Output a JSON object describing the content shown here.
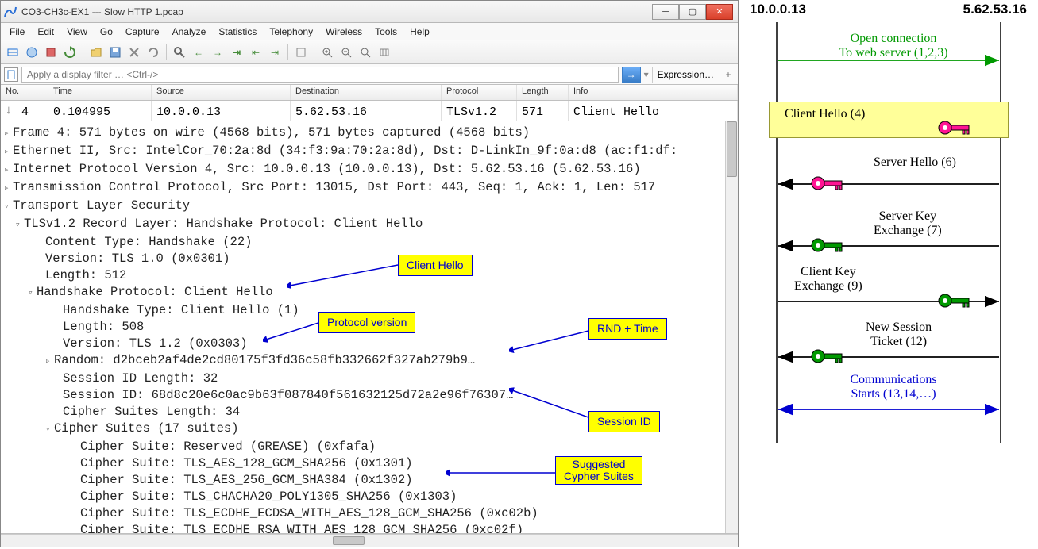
{
  "titlebar": {
    "title": "CO3-CH3c-EX1 --- Slow HTTP 1.pcap"
  },
  "menu": {
    "items": [
      "File",
      "Edit",
      "View",
      "Go",
      "Capture",
      "Analyze",
      "Statistics",
      "Telephony",
      "Wireless",
      "Tools",
      "Help"
    ]
  },
  "filter": {
    "placeholder": "Apply a display filter … <Ctrl-/>",
    "expression": "Expression…"
  },
  "packet_list": {
    "columns": [
      "No.",
      "Time",
      "Source",
      "Destination",
      "Protocol",
      "Length",
      "Info"
    ],
    "row": {
      "no": "4",
      "time": "0.104995",
      "src": "10.0.0.13",
      "dst": "5.62.53.16",
      "proto": "TLSv1.2",
      "len": "571",
      "info": "Client Hello"
    }
  },
  "details": {
    "frame": "Frame 4: 571 bytes on wire (4568 bits), 571 bytes captured (4568 bits)",
    "eth": "Ethernet II, Src: IntelCor_70:2a:8d (34:f3:9a:70:2a:8d), Dst: D-LinkIn_9f:0a:d8 (ac:f1:df:",
    "ip": "Internet Protocol Version 4, Src: 10.0.0.13 (10.0.0.13), Dst: 5.62.53.16 (5.62.53.16)",
    "tcp": "Transmission Control Protocol, Src Port: 13015, Dst Port: 443, Seq: 1, Ack: 1, Len: 517",
    "tls": "Transport Layer Security",
    "record": "TLSv1.2 Record Layer: Handshake Protocol: Client Hello",
    "ctype": "Content Type: Handshake (22)",
    "ver_rec": "Version: TLS 1.0 (0x0301)",
    "len_rec": "Length: 512",
    "hsproto": "Handshake Protocol: Client Hello",
    "hstype": "Handshake Type: Client Hello (1)",
    "hs_len": "Length: 508",
    "hs_ver": "Version: TLS 1.2 (0x0303)",
    "random": "Random: d2bceb2af4de2cd80175f3fd36c58fb332662f327ab279b9…",
    "sid_len": "Session ID Length: 32",
    "sid": "Session ID: 68d8c20e6c0ac9b63f087840f561632125d72a2e96f76307…",
    "cs_len": "Cipher Suites Length: 34",
    "cs_head": "Cipher Suites (17 suites)",
    "cs1": "Cipher Suite: Reserved (GREASE) (0xfafa)",
    "cs2": "Cipher Suite: TLS_AES_128_GCM_SHA256 (0x1301)",
    "cs3": "Cipher Suite: TLS_AES_256_GCM_SHA384 (0x1302)",
    "cs4": "Cipher Suite: TLS_CHACHA20_POLY1305_SHA256 (0x1303)",
    "cs5": "Cipher Suite: TLS_ECDHE_ECDSA_WITH_AES_128_GCM_SHA256 (0xc02b)",
    "cs6": "Cipher Suite: TLS ECDHE RSA WITH AES 128 GCM SHA256 (0xc02f)"
  },
  "annotations": {
    "client_hello": "Client Hello",
    "proto_ver": "Protocol version",
    "rnd_time": "RND + Time",
    "session_id": "Session ID",
    "cyphers": "Suggested\nCypher Suites"
  },
  "seq": {
    "left_addr": "10.0.0.13",
    "right_addr": "5.62.53.16",
    "open": "Open connection\nTo web server (1,2,3)",
    "client_hello": "Client Hello (4)",
    "server_hello": "Server Hello (6)",
    "skey": "Server Key\nExchange (7)",
    "ckey": "Client Key\nExchange (9)",
    "ticket": "New Session\nTicket (12)",
    "comm": "Communications\nStarts (13,14,…)"
  }
}
